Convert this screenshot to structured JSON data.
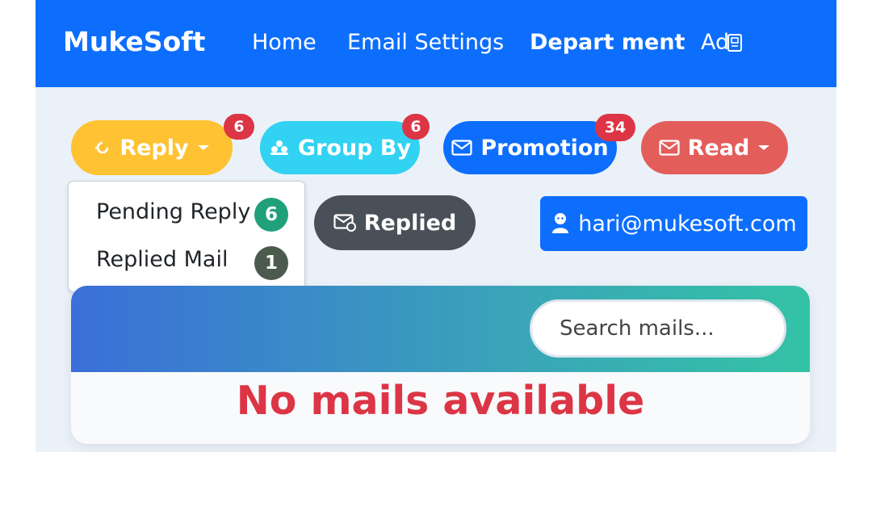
{
  "navbar": {
    "brand": "MukeSoft",
    "links": [
      "Home",
      "Email Settings",
      "Depart ment",
      "Ad"
    ],
    "color": "#0d6efd"
  },
  "filters": {
    "reply": {
      "label": "Reply",
      "badge": "6",
      "color": "#ffc233",
      "icon": "reply-icon"
    },
    "group_by": {
      "label": "Group By",
      "badge": "6",
      "color": "#31d2f2",
      "icon": "group-icon"
    },
    "promotion": {
      "label": "Promotion",
      "badge": "34",
      "color": "#0d6efd",
      "icon": "envelope-icon"
    },
    "read": {
      "label": "Read",
      "color": "#e35d5b",
      "icon": "envelope-icon"
    },
    "replied": {
      "label": "Replied",
      "color": "#495057",
      "icon": "envelope-check-icon"
    },
    "user": {
      "label": "hari@mukesoft.com",
      "color": "#0d6efd",
      "icon": "user-icon"
    }
  },
  "reply_dropdown": {
    "items": [
      {
        "label": "Pending Reply",
        "count": "6",
        "color": "#20a07a"
      },
      {
        "label": "Replied Mail",
        "count": "1",
        "color": "#4b5a4d"
      }
    ]
  },
  "mails": {
    "search_placeholder": "Search mails...",
    "empty_message": "No mails available"
  }
}
